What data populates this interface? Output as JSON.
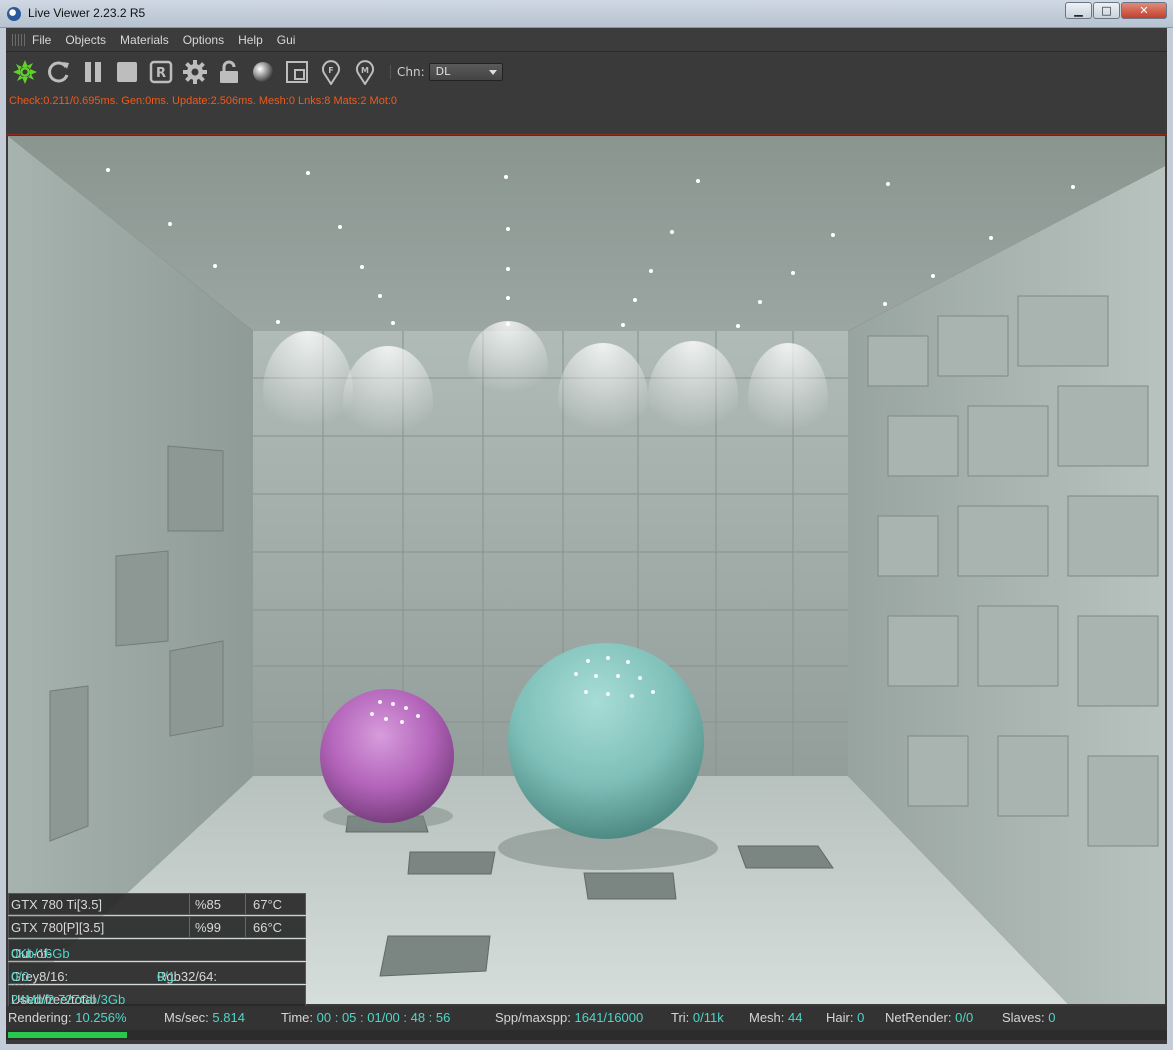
{
  "window": {
    "title": "Live Viewer 2.23.2 R5",
    "min": "▁",
    "max": "□",
    "close": "✕"
  },
  "menu": [
    "File",
    "Objects",
    "Materials",
    "Options",
    "Help",
    "Gui"
  ],
  "toolbar": {
    "tools": [
      "render-icon",
      "restart-icon",
      "pause-icon",
      "stop-icon",
      "region-icon",
      "settings-icon",
      "lock-icon",
      "material-sphere-icon",
      "clay-icon",
      "focus-pin-icon",
      "material-pin-icon"
    ],
    "region_letter": "R",
    "focus_letter": "F",
    "material_letter": "M",
    "chn_label": "Chn:",
    "chn_value": "DL"
  },
  "stats": "Check:0.211/0.695ms. Gen:0ms. Update:2.506ms. Mesh:0 Lnks:8 Mats:2 Mot:0",
  "gpus": [
    {
      "name": "GTX 780 Ti[3.5]",
      "load": "%85",
      "temp": "67°C"
    },
    {
      "name": "GTX 780[P][3.5]",
      "load": "%99",
      "temp": "66°C"
    }
  ],
  "memory": {
    "ooc_label": "Out-of-core used/max:",
    "ooc_value": "0Kb/16Gb",
    "grey_label": "Grey8/16:",
    "grey_value": "0/0",
    "rgb_label": "Rgb32/64:",
    "rgb_value": "0/1",
    "vram_label": "Used/free/total vram:",
    "vram_value": "24Mb/2.727Gb/3Gb"
  },
  "status": {
    "rendering_label": "Rendering:",
    "rendering_value": "10.256%",
    "ms_label": "Ms/sec:",
    "ms_value": "5.814",
    "time_label": "Time:",
    "time_value": "00 : 05 : 01/00 : 48 : 56",
    "spp_label": "Spp/maxspp:",
    "spp_value": "1641/16000",
    "tri_label": "Tri:",
    "tri_value": "0/11k",
    "mesh_label": "Mesh:",
    "mesh_value": "44",
    "hair_label": "Hair:",
    "hair_value": "0",
    "net_label": "NetRender:",
    "net_value": "0/0",
    "slaves_label": "Slaves:",
    "slaves_value": "0",
    "progress": 0.10256
  },
  "colors": {
    "accent_value": "#4fd6c8",
    "stats_text": "#f05a1a",
    "progress": "#29c64d"
  }
}
